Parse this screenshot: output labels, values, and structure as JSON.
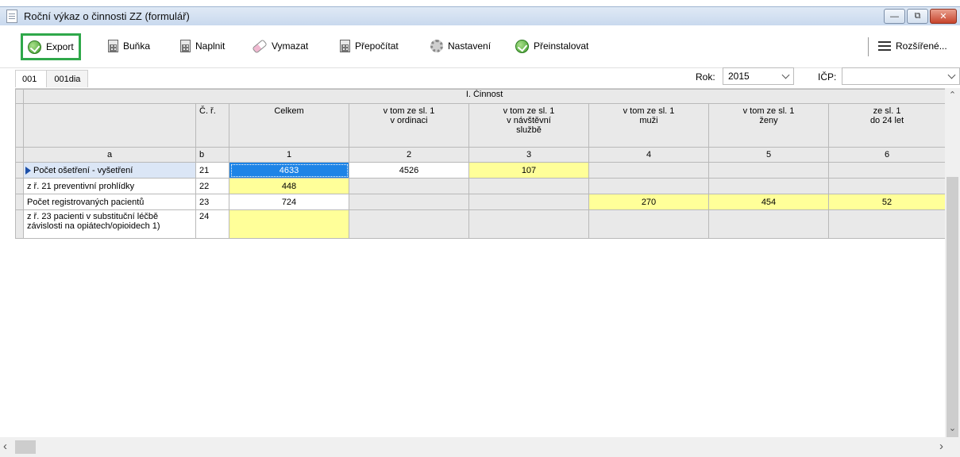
{
  "window": {
    "title": "Roční výkaz o činnosti ZZ (formulář)",
    "controls": [
      "minimize",
      "restore",
      "close"
    ]
  },
  "toolbar": {
    "export": "Export",
    "bunka": "Buňka",
    "naplnit": "Naplnit",
    "vymazat": "Vymazat",
    "prepocitat": "Přepočítat",
    "nastaveni": "Nastavení",
    "preinstalovat": "Přeinstalovat",
    "rozsirene": "Rozšířené...",
    "icons": {
      "export": "green-check-icon",
      "bunka": "calculator-icon",
      "naplnit": "calculator-icon",
      "vymazat": "eraser-icon",
      "prepocitat": "calculator-icon",
      "nastaveni": "gear-icon",
      "preinstalovat": "green-check-icon",
      "rozsirene": "menu-icon"
    },
    "highlight_color": "#2fa84a"
  },
  "tabs": [
    "001",
    "001dia"
  ],
  "filters": {
    "rok_label": "Rok:",
    "rok_value": "2015",
    "icp_label": "IČP:",
    "icp_value": ""
  },
  "grid": {
    "group_header": "I. Činnost",
    "col_cr": "Č. ř.",
    "columns": [
      [
        "Celkem"
      ],
      [
        "v tom ze sl. 1",
        "v ordinaci"
      ],
      [
        "v tom ze sl. 1",
        "v návštěvní",
        "službě"
      ],
      [
        "v tom ze sl. 1",
        "muži"
      ],
      [
        "v tom ze sl. 1",
        "ženy"
      ],
      [
        "ze sl. 1",
        "do 24 let"
      ]
    ],
    "index_row": {
      "a": "a",
      "b": "b",
      "cols": [
        "1",
        "2",
        "3",
        "4",
        "5",
        "6"
      ]
    },
    "rows": [
      {
        "label": [
          "Počet ošetření - vyšetření"
        ],
        "cr": "21",
        "values": [
          "4633",
          "4526",
          "107",
          "",
          "",
          ""
        ]
      },
      {
        "label": [
          "z ř. 21 preventivní prohlídky"
        ],
        "cr": "22",
        "values": [
          "448",
          "",
          "",
          "",
          "",
          ""
        ]
      },
      {
        "label": [
          "Počet registrovaných pacientů"
        ],
        "cr": "23",
        "values": [
          "724",
          "",
          "",
          "270",
          "454",
          "52"
        ]
      },
      {
        "label": [
          "z ř. 23 pacienti v substituční léčbě",
          "závislosti na opiátech/opioidech 1)"
        ],
        "cr": "24",
        "values": [
          "",
          "",
          "",
          "",
          "",
          ""
        ]
      }
    ],
    "colors": {
      "yellow": "#ffff99",
      "selected": "#1e84e6",
      "gray": "#e9e9e9"
    }
  }
}
